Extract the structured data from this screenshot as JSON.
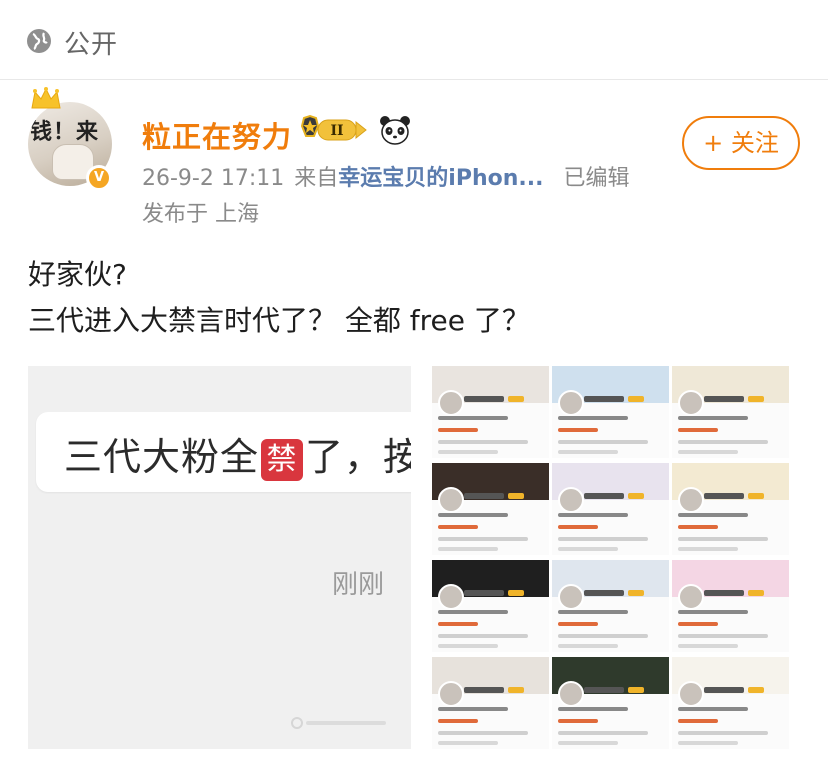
{
  "header": {
    "visibility_label": "公开",
    "visibility_icon": "globe-icon"
  },
  "author": {
    "name": "粒正在努力",
    "avatar_text": "钱！来",
    "member_badge": "II",
    "verified_badge": "V",
    "timestamp": "26-9-2 17:11",
    "source_prefix": "来自",
    "source": "幸运宝贝的iPhon...",
    "edited": "已编辑",
    "location": "发布于 上海",
    "follow_label": "+ 关注",
    "colors": {
      "name": "#f07d0c",
      "source": "#5b7cae",
      "meta": "#8a8a8a"
    }
  },
  "post": {
    "lines": [
      "好家伙?",
      "三代进入大禁言时代了？ 全都 free 了？"
    ]
  },
  "image_left": {
    "bubble_before": "三代大粉全",
    "bubble_emoji": "禁",
    "bubble_after": "了，按",
    "time_label": "刚刚"
  },
  "image_grid": {
    "cards": [
      {
        "header_color": "#e9e4df"
      },
      {
        "header_color": "#cfe0ee"
      },
      {
        "header_color": "#efe8d7"
      },
      {
        "header_color": "#3a2e28"
      },
      {
        "header_color": "#e8e3ee"
      },
      {
        "header_color": "#f3ead2"
      },
      {
        "header_color": "#1f1f1f"
      },
      {
        "header_color": "#dfe6ee"
      },
      {
        "header_color": "#f4d6e4"
      },
      {
        "header_color": "#e7e2dc"
      },
      {
        "header_color": "#2f3a2c"
      },
      {
        "header_color": "#f6f3ec"
      }
    ]
  }
}
